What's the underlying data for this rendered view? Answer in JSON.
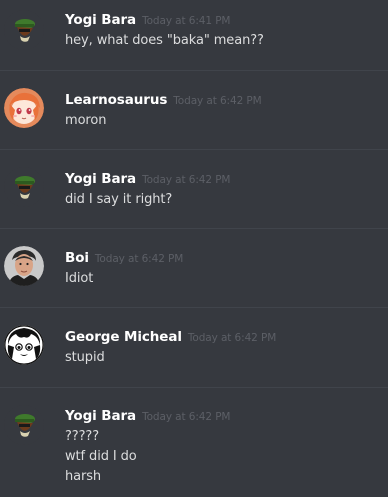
{
  "messages": [
    {
      "username": "Yogi Bara",
      "timestamp": "Today at 6:41 PM",
      "avatar_icon": "green-hat-character-avatar-icon",
      "lines": [
        "hey, what does \"baka\" mean??"
      ]
    },
    {
      "username": "Learnosaurus",
      "timestamp": "Today at 6:42 PM",
      "avatar_icon": "orange-hair-anime-avatar-icon",
      "lines": [
        "moron"
      ]
    },
    {
      "username": "Yogi Bara",
      "timestamp": "Today at 6:42 PM",
      "avatar_icon": "green-hat-character-avatar-icon",
      "lines": [
        "did I say it right?"
      ]
    },
    {
      "username": "Boi",
      "timestamp": "Today at 6:42 PM",
      "avatar_icon": "man-portrait-avatar-icon",
      "lines": [
        "Idiot"
      ]
    },
    {
      "username": "George Micheal",
      "timestamp": "Today at 6:42 PM",
      "avatar_icon": "manga-face-avatar-icon",
      "lines": [
        "stupid"
      ]
    },
    {
      "username": "Yogi Bara",
      "timestamp": "Today at 6:42 PM",
      "avatar_icon": "green-hat-character-avatar-icon",
      "lines": [
        "?????",
        "wtf did I do",
        "harsh"
      ]
    }
  ],
  "colors": {
    "background": "#36393f",
    "username": "#ffffff",
    "timestamp": "#5c5f66",
    "message_text": "#dcddde",
    "divider": "#40444b"
  }
}
